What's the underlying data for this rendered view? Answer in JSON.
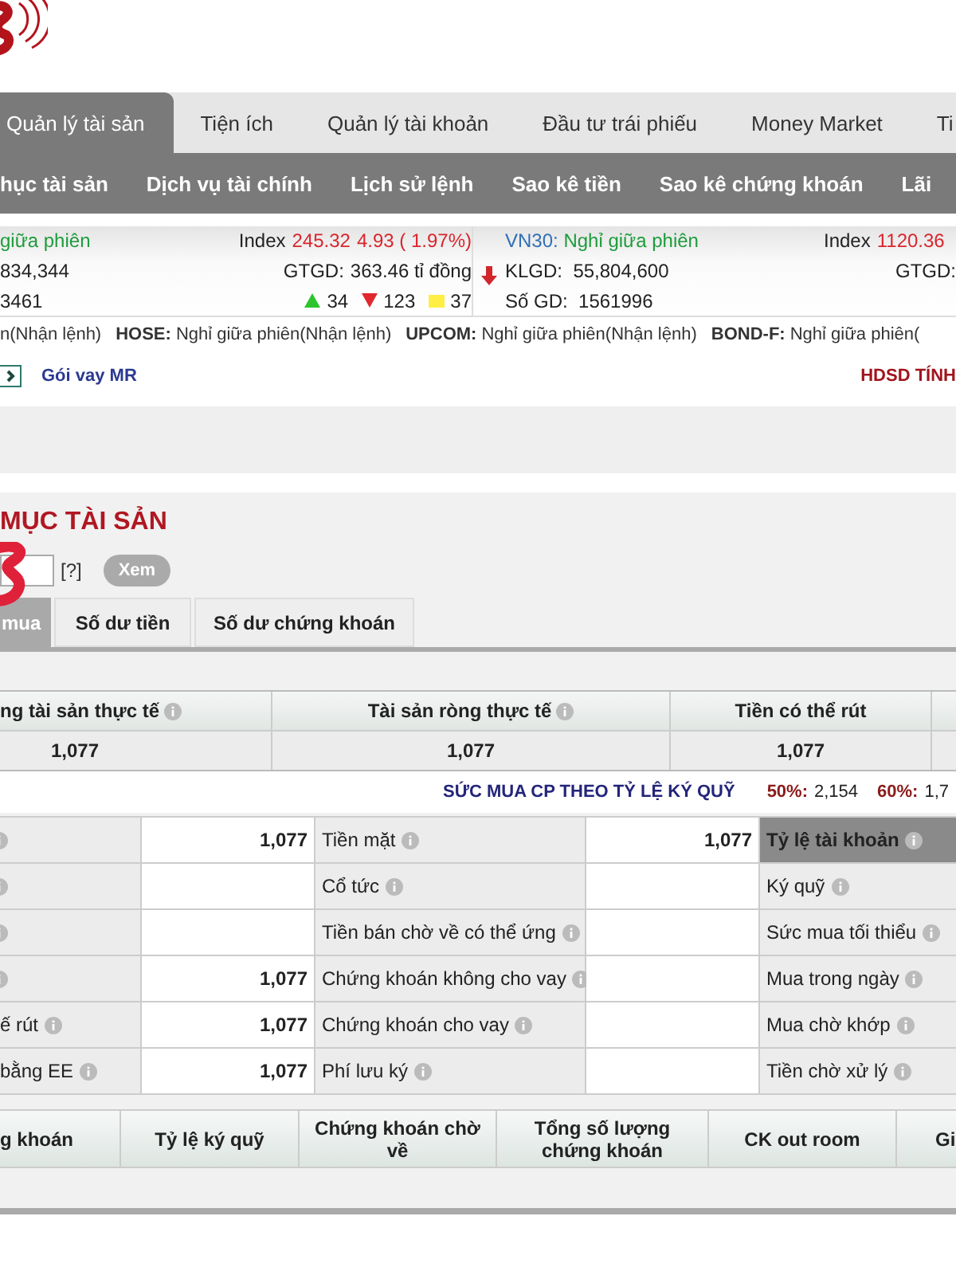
{
  "main_tabs": [
    {
      "label": "Quản lý tài sản",
      "selected": true
    },
    {
      "label": "Tiện ích",
      "selected": false
    },
    {
      "label": "Quản lý tài khoản",
      "selected": false
    },
    {
      "label": "Đầu tư trái phiếu",
      "selected": false
    },
    {
      "label": "Money Market",
      "selected": false
    },
    {
      "label": "Ti",
      "selected": false
    }
  ],
  "sub_nav": [
    "hục tài sản",
    "Dịch vụ tài chính",
    "Lịch sử lệnh",
    "Sao kê tiền",
    "Sao kê chứng khoán",
    "Lãi"
  ],
  "market": {
    "panel_1": {
      "status": "giữa phiên",
      "index_label": "Index",
      "index": "245.32",
      "change": "4.93 ( 1.97%)",
      "volume": "834,344",
      "value_label": "GTGD:",
      "value": "363.46 tỉ đồng",
      "trades": "3461",
      "up": "34",
      "down": "123",
      "flat": "37"
    },
    "panel_2": {
      "name": "VN30:",
      "status": "Nghỉ giữa phiên",
      "index_label": "Index",
      "index": "1120.36",
      "volume_label": "KLGD:",
      "volume": "55,804,600",
      "value_label": "GTGD:",
      "trades_label": "Số GD:",
      "trades": "1561996"
    }
  },
  "session_status": [
    {
      "text": "n(Nhận lệnh)"
    },
    {
      "exchange": "HOSE:",
      "text": "Nghỉ giữa phiên(Nhận lệnh)"
    },
    {
      "exchange": "UPCOM:",
      "text": "Nghỉ giữa phiên(Nhận lệnh)"
    },
    {
      "exchange": "BOND-F:",
      "text": "Nghỉ giữa phiên("
    }
  ],
  "links": {
    "loan": "Gói vay MR",
    "guide": "HDSD TÍNH"
  },
  "section": {
    "title": "MỤC TÀI SẢN",
    "help": "[?]",
    "view_button": "Xem"
  },
  "sub_tabs": [
    {
      "label": "mua",
      "selected": true
    },
    {
      "label": "Số dư tiền",
      "selected": false
    },
    {
      "label": "Số dư chứng khoán",
      "selected": false
    }
  ],
  "summary": {
    "columns": [
      {
        "label": "ng tài sản thực tế",
        "info": true
      },
      {
        "label": "Tài sản ròng thực tế",
        "info": true
      },
      {
        "label": "Tiền có thể rút",
        "info": false
      }
    ],
    "values": [
      "1,077",
      "1,077",
      "1,077"
    ]
  },
  "buying_power": {
    "title": "SỨC MUA CP THEO TỶ LỆ KÝ QUỸ",
    "items": [
      {
        "label": "50%:",
        "value": "2,154"
      },
      {
        "label": "60%:",
        "value": "1,7"
      }
    ]
  },
  "details": [
    {
      "value_1": "1,077",
      "label_2": "Tiền mặt",
      "value_2": "1,077",
      "label_3": "Tỷ lệ tài khoản",
      "label_3_highlighted": true
    },
    {
      "label_2": "Cổ tức",
      "label_3": "Ký quỹ",
      "label_3_highlighted": false
    },
    {
      "label_2": "Tiền bán chờ về có thể ứng",
      "label_3": "Sức mua tối thiểu",
      "label_3_highlighted": false
    },
    {
      "value_1": "1,077",
      "label_2": "Chứng khoán không cho vay",
      "label_3": "Mua trong ngày",
      "label_3_highlighted": false
    },
    {
      "label_1": "ế rút",
      "value_1": "1,077",
      "label_2": "Chứng khoán cho vay",
      "label_3": "Mua chờ khớp",
      "label_3_highlighted": false
    },
    {
      "label_1": "bằng EE",
      "value_1": "1,077",
      "label_2": "Phí lưu ký",
      "label_3": "Tiền chờ xử lý",
      "label_3_highlighted": false
    }
  ],
  "holdings_columns": [
    "g khoán",
    "Tỷ lệ ký quỹ",
    "Chứng khoán chờ về",
    "Tổng số lượng chứng khoán",
    "CK out room",
    "Gi"
  ]
}
